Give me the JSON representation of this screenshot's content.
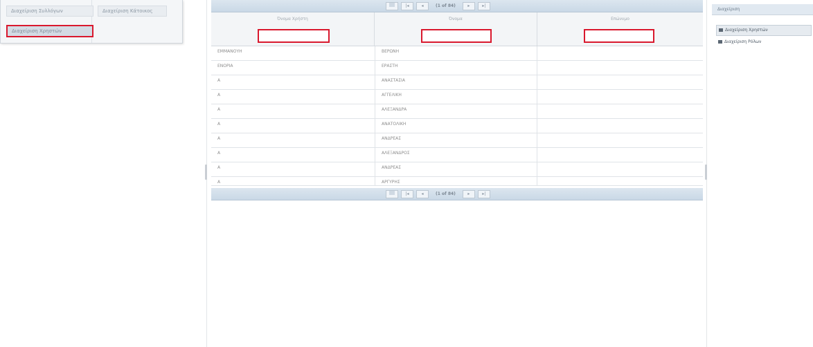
{
  "left_menu": {
    "items": [
      {
        "label": "Διαχείριση Συλλόγων"
      },
      {
        "label": "Διαχείριση Κάτοικος"
      },
      {
        "label": "Διαχείριση Χρηστών"
      }
    ]
  },
  "pager": {
    "page_size_icon": "dropdown-icon",
    "first_label": "|◂",
    "prev_label": "◂",
    "page_info": "(1 of 84)",
    "next_label": "▸",
    "last_label": "▸|"
  },
  "grid": {
    "columns": [
      {
        "label": "Όνομα Χρήστη"
      },
      {
        "label": "Όνομα"
      },
      {
        "label": "Επώνυμο"
      }
    ],
    "rows": [
      {
        "c1": "ΕΜΜΑΝΟΥΗ",
        "c2": "ΒΕΡΩΝΗ",
        "c3": ""
      },
      {
        "c1": "ΕΝΟΡΙΑ",
        "c2": "ΕΡΑΣΤΗ",
        "c3": ""
      },
      {
        "c1": "Α",
        "c2": "ΑΝΑΣΤΑΣΙΑ",
        "c3": ""
      },
      {
        "c1": "Α",
        "c2": "ΑΓΓΕΛΙΚΗ",
        "c3": ""
      },
      {
        "c1": "Α",
        "c2": "ΑΛΕΞΑΝΔΡΑ",
        "c3": ""
      },
      {
        "c1": "Α",
        "c2": "ΑΝΑΤΟΛΙΚΗ",
        "c3": ""
      },
      {
        "c1": "Α",
        "c2": "ΑΝΔΡΕΑΣ",
        "c3": ""
      },
      {
        "c1": "Α",
        "c2": "ΑΛΕΞΑΝΔΡΟΣ",
        "c3": ""
      },
      {
        "c1": "Α",
        "c2": "ΑΝΔΡΕΑΣ",
        "c3": ""
      },
      {
        "c1": "Α",
        "c2": "ΑΡΓΥΡΗΣ",
        "c3": ""
      }
    ]
  },
  "right_panel": {
    "header": "Διαχείριση",
    "items": [
      {
        "label": "Διαχείριση Χρηστών",
        "icon": "user-icon"
      },
      {
        "label": "Διαχείριση Ρόλων",
        "icon": "role-icon"
      }
    ]
  },
  "colors": {
    "highlight_border": "#d9182d",
    "pager_background": "#c9d8e6"
  }
}
